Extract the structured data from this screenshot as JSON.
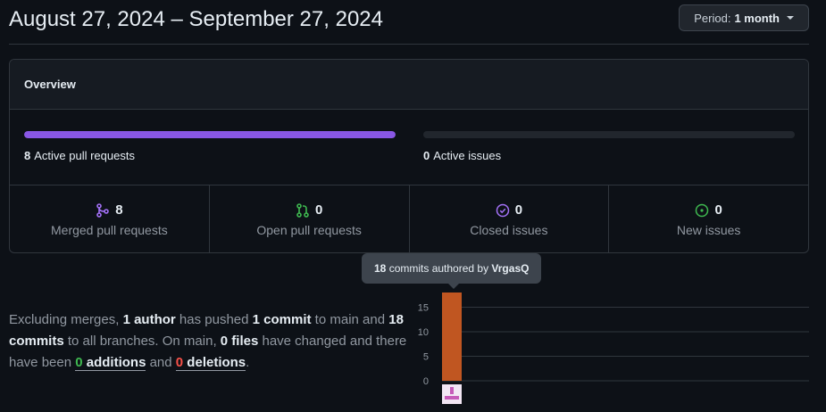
{
  "header": {
    "date_range": "August 27, 2024 – September 27, 2024",
    "period_prefix": "Period:",
    "period_value": "1 month"
  },
  "overview": {
    "title": "Overview",
    "active_prs": {
      "count": "8",
      "label": "Active pull requests",
      "fill": 1.0,
      "color": "#8957e5"
    },
    "active_issues": {
      "count": "0",
      "label": "Active issues",
      "fill": 0.0
    },
    "stats": [
      {
        "icon": "merge-icon",
        "value": "8",
        "label": "Merged pull requests",
        "color": "#a371f7"
      },
      {
        "icon": "open-pr-icon",
        "value": "0",
        "label": "Open pull requests",
        "color": "#3fb950"
      },
      {
        "icon": "closed-issue-icon",
        "value": "0",
        "label": "Closed issues",
        "color": "#a371f7"
      },
      {
        "icon": "new-issue-icon",
        "value": "0",
        "label": "New issues",
        "color": "#3fb950"
      }
    ]
  },
  "summary": {
    "t1": "Excluding merges, ",
    "authors": "1 author",
    "t2": " has pushed ",
    "commits_main": "1 commit",
    "t3": " to main and ",
    "commits_all": "18 commits",
    "t4": " to all branches. On main, ",
    "files": "0 files",
    "t5": " have changed and there have been ",
    "additions_num": "0",
    "additions_word": " additions",
    "t6": " and ",
    "deletions_num": "0",
    "deletions_word": " deletions",
    "t7": "."
  },
  "tooltip": {
    "count": "18",
    "text": " commits authored by ",
    "user": "VrgasQ"
  },
  "chart_data": {
    "type": "bar",
    "categories": [
      "VrgasQ"
    ],
    "values": [
      18
    ],
    "yticks": [
      0,
      5,
      10,
      15
    ],
    "ylim": [
      0,
      18
    ],
    "bar_color": "#c05621",
    "grid": true
  }
}
